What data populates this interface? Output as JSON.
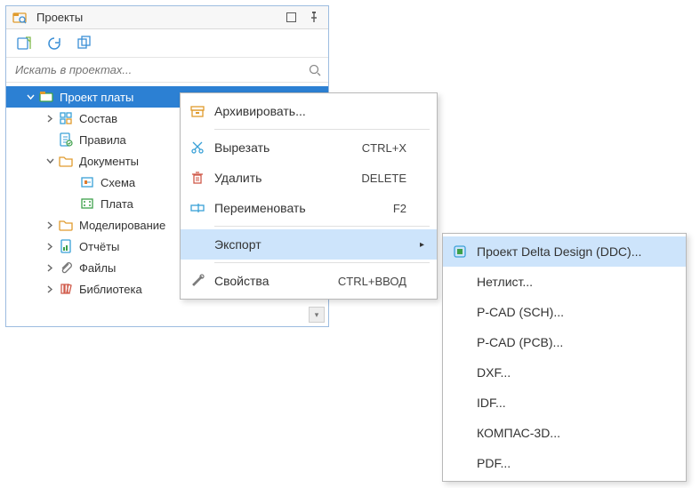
{
  "panel": {
    "title": "Проекты",
    "search_placeholder": "Искать в проектах..."
  },
  "tree": {
    "root": {
      "label": "Проект платы"
    },
    "sostav": {
      "label": "Состав"
    },
    "pravila": {
      "label": "Правила"
    },
    "documents": {
      "label": "Документы"
    },
    "schema": {
      "label": "Схема"
    },
    "plata": {
      "label": "Плата"
    },
    "model": {
      "label": "Моделирование"
    },
    "reports": {
      "label": "Отчёты"
    },
    "files": {
      "label": "Файлы"
    },
    "library": {
      "label": "Библиотека"
    }
  },
  "menu": {
    "archive": {
      "label": "Архивировать..."
    },
    "cut": {
      "label": "Вырезать",
      "shortcut": "CTRL+X"
    },
    "delete": {
      "label": "Удалить",
      "shortcut": "DELETE"
    },
    "rename": {
      "label": "Переименовать",
      "shortcut": "F2"
    },
    "export": {
      "label": "Экспорт"
    },
    "props": {
      "label": "Свойства",
      "shortcut": "CTRL+ВВОД"
    }
  },
  "submenu": {
    "ddc": {
      "label": "Проект Delta Design (DDC)..."
    },
    "netlist": {
      "label": "Нетлист..."
    },
    "sch": {
      "label": "P-CAD (SCH)..."
    },
    "pcb": {
      "label": "P-CAD (PCB)..."
    },
    "dxf": {
      "label": "DXF..."
    },
    "idf": {
      "label": "IDF..."
    },
    "kompas": {
      "label": "КОМПАС-3D..."
    },
    "pdf": {
      "label": "PDF..."
    }
  }
}
